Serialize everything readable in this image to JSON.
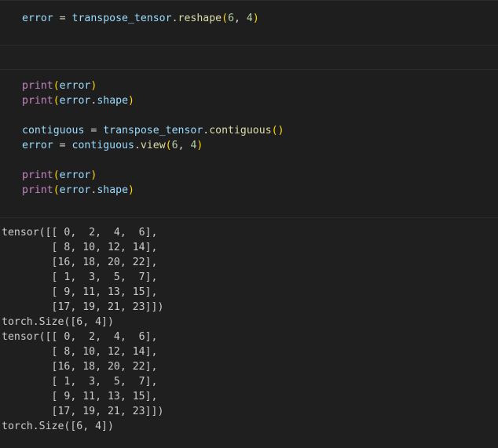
{
  "cells": [
    {
      "lines": [
        [
          {
            "t": "error",
            "c": "var"
          },
          {
            "t": " = ",
            "c": "op"
          },
          {
            "t": "transpose_tensor",
            "c": "var"
          },
          {
            "t": ".",
            "c": "op"
          },
          {
            "t": "reshape",
            "c": "fn"
          },
          {
            "t": "(",
            "c": "p1"
          },
          {
            "t": "6",
            "c": "num"
          },
          {
            "t": ", ",
            "c": "op"
          },
          {
            "t": "4",
            "c": "num"
          },
          {
            "t": ")",
            "c": "p1"
          }
        ]
      ]
    },
    {
      "lines": [
        [
          {
            "t": "print",
            "c": "kw"
          },
          {
            "t": "(",
            "c": "p1"
          },
          {
            "t": "error",
            "c": "var"
          },
          {
            "t": ")",
            "c": "p1"
          }
        ],
        [
          {
            "t": "print",
            "c": "kw"
          },
          {
            "t": "(",
            "c": "p1"
          },
          {
            "t": "error",
            "c": "var"
          },
          {
            "t": ".",
            "c": "op"
          },
          {
            "t": "shape",
            "c": "var"
          },
          {
            "t": ")",
            "c": "p1"
          }
        ],
        [],
        [
          {
            "t": "contiguous",
            "c": "var"
          },
          {
            "t": " = ",
            "c": "op"
          },
          {
            "t": "transpose_tensor",
            "c": "var"
          },
          {
            "t": ".",
            "c": "op"
          },
          {
            "t": "contiguous",
            "c": "fn"
          },
          {
            "t": "()",
            "c": "p1"
          }
        ],
        [
          {
            "t": "error",
            "c": "var"
          },
          {
            "t": " = ",
            "c": "op"
          },
          {
            "t": "contiguous",
            "c": "var"
          },
          {
            "t": ".",
            "c": "op"
          },
          {
            "t": "view",
            "c": "fn"
          },
          {
            "t": "(",
            "c": "p1"
          },
          {
            "t": "6",
            "c": "num"
          },
          {
            "t": ", ",
            "c": "op"
          },
          {
            "t": "4",
            "c": "num"
          },
          {
            "t": ")",
            "c": "p1"
          }
        ],
        [],
        [
          {
            "t": "print",
            "c": "kw"
          },
          {
            "t": "(",
            "c": "p1"
          },
          {
            "t": "error",
            "c": "var"
          },
          {
            "t": ")",
            "c": "p1"
          }
        ],
        [
          {
            "t": "print",
            "c": "kw"
          },
          {
            "t": "(",
            "c": "p1"
          },
          {
            "t": "error",
            "c": "var"
          },
          {
            "t": ".",
            "c": "op"
          },
          {
            "t": "shape",
            "c": "var"
          },
          {
            "t": ")",
            "c": "p1"
          }
        ]
      ]
    }
  ],
  "output": {
    "lines": [
      "tensor([[ 0,  2,  4,  6],",
      "        [ 8, 10, 12, 14],",
      "        [16, 18, 20, 22],",
      "        [ 1,  3,  5,  7],",
      "        [ 9, 11, 13, 15],",
      "        [17, 19, 21, 23]])",
      "torch.Size([6, 4])",
      "tensor([[ 0,  2,  4,  6],",
      "        [ 8, 10, 12, 14],",
      "        [16, 18, 20, 22],",
      "        [ 1,  3,  5,  7],",
      "        [ 9, 11, 13, 15],",
      "        [17, 19, 21, 23]])",
      "torch.Size([6, 4])"
    ]
  }
}
